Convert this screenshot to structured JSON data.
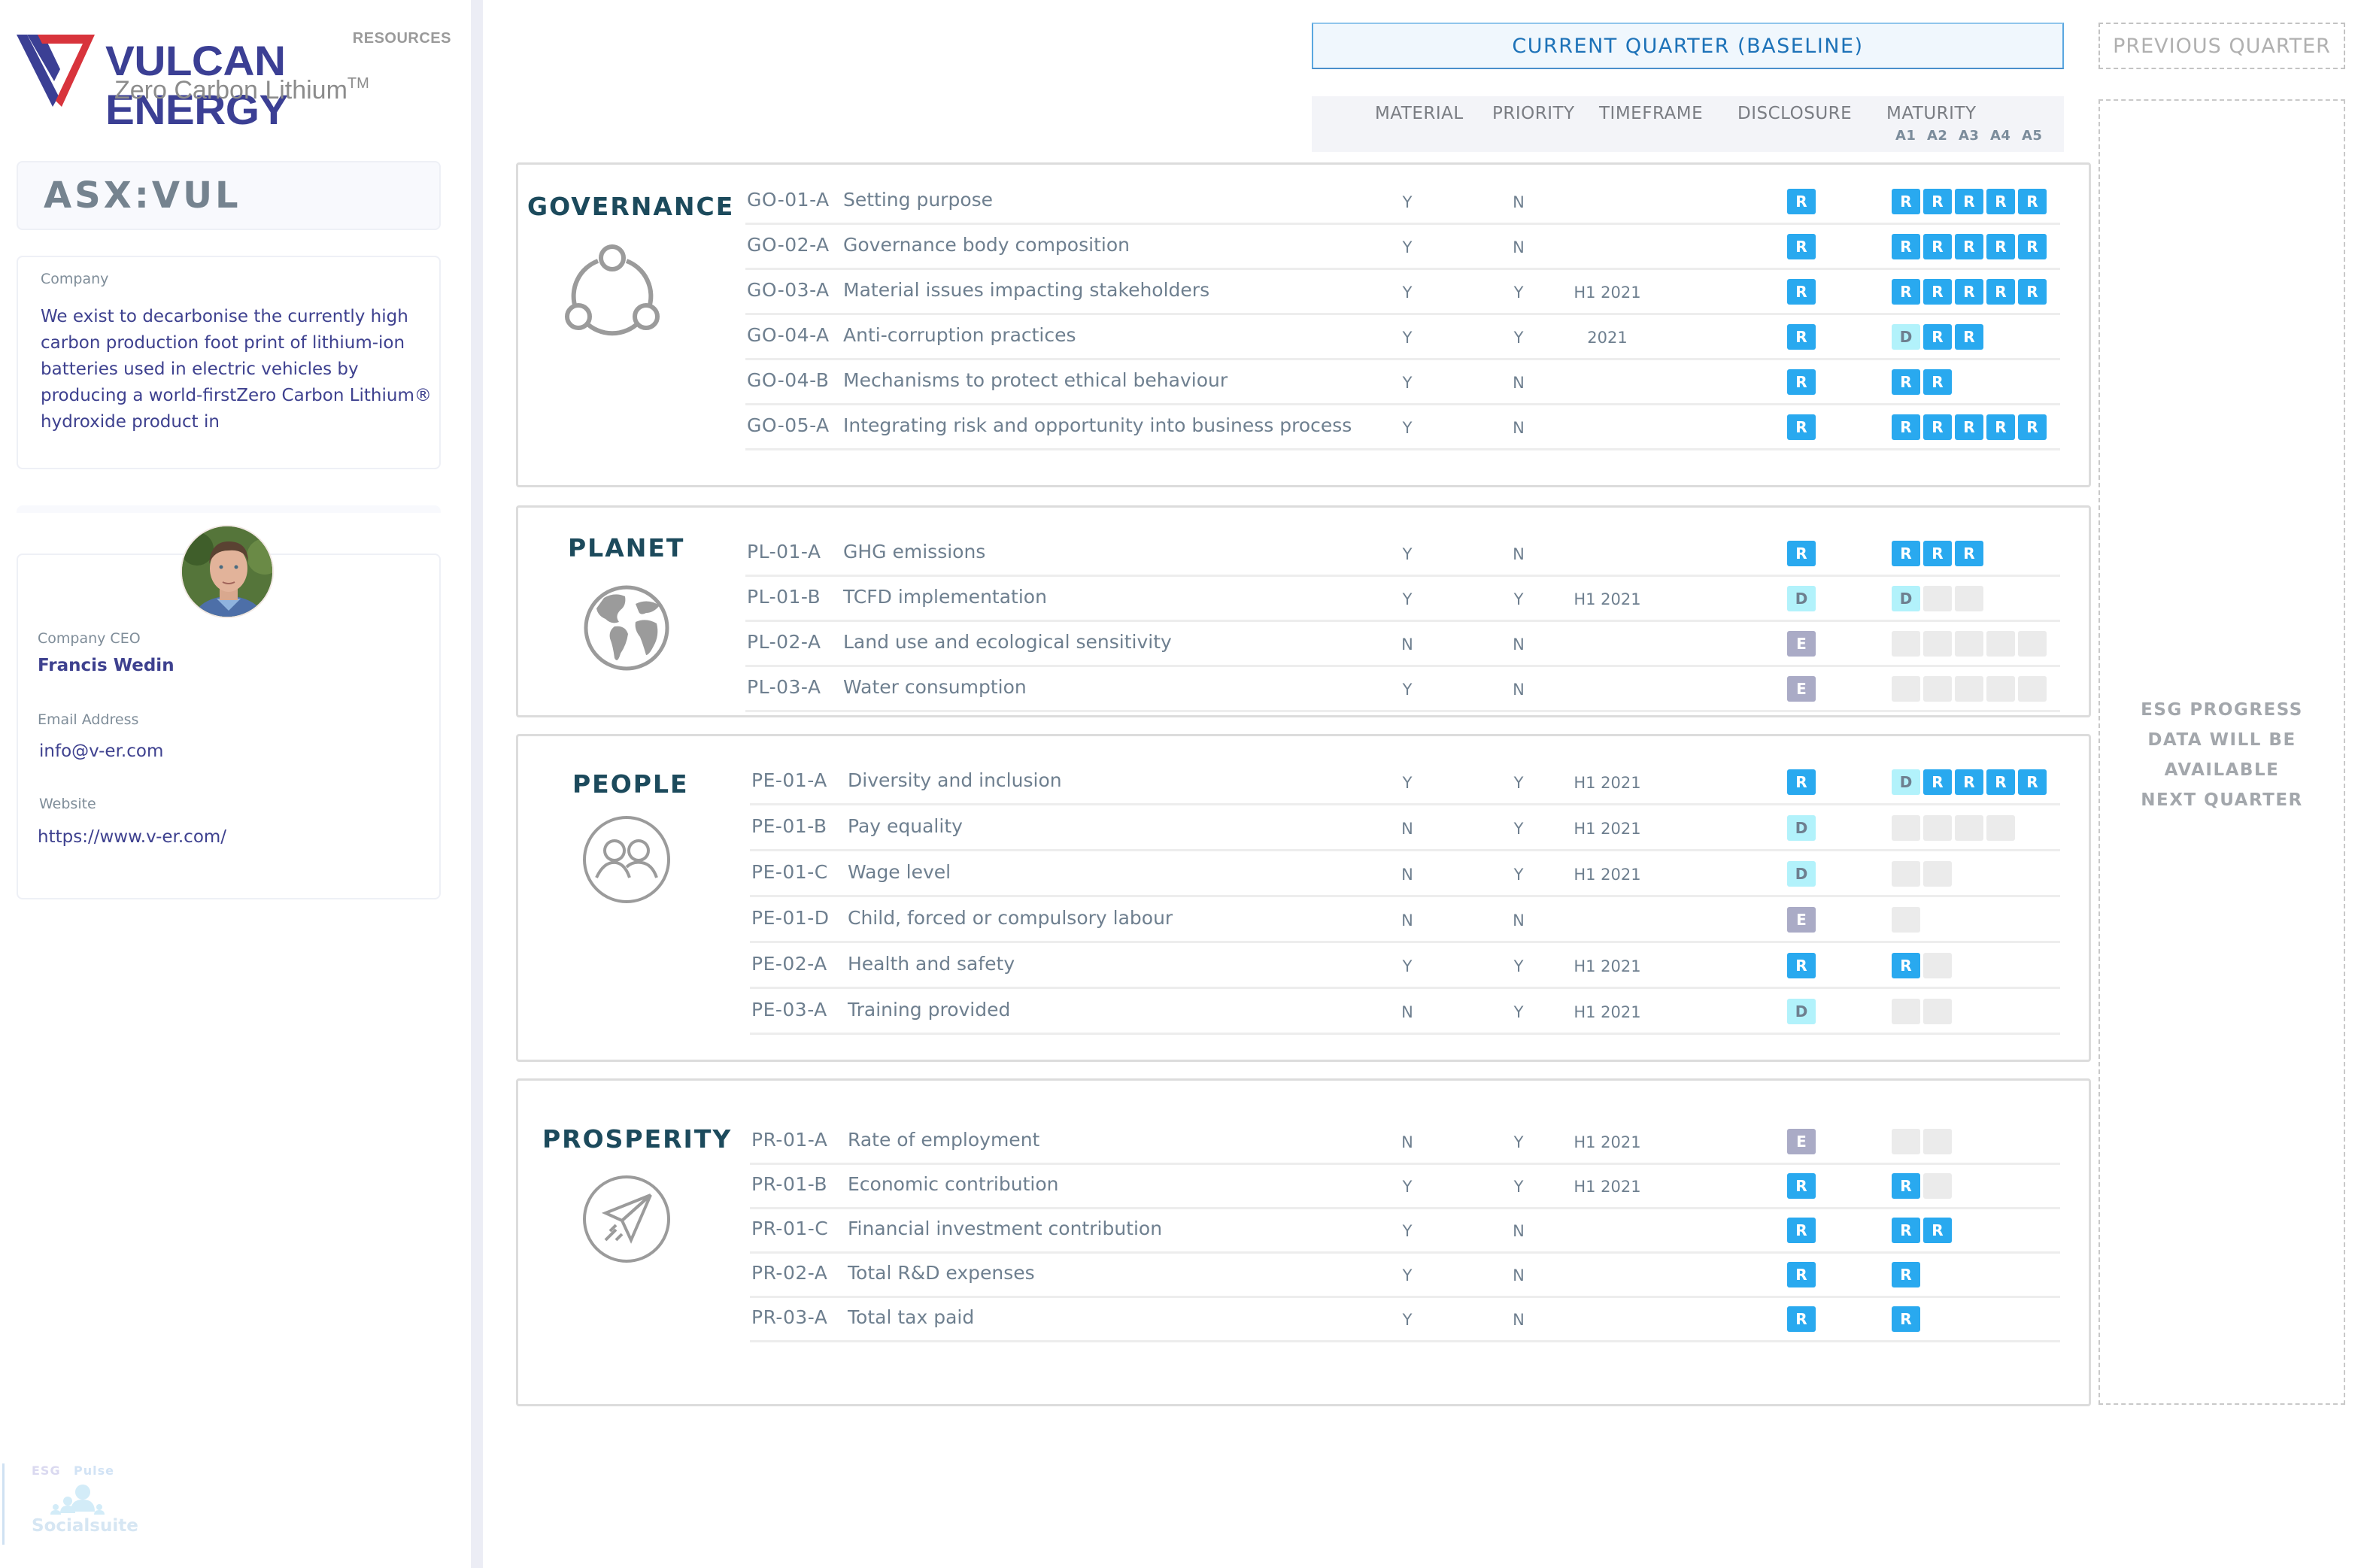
{
  "sidebar": {
    "logo": {
      "resources": "RESOURCES",
      "brand": "VULCAN ENERGY",
      "tagline": "Zero Carbon Lithium",
      "trademark": "TM"
    },
    "ticker": "ASX:VUL",
    "company": {
      "label": "Company",
      "description": "We exist to decarbonise the currently high carbon production foot print of lithium-ion batteries used in electric vehicles by producing a world-firstZero Carbon Lithium® hydroxide product in"
    },
    "ceo": {
      "ceo_label": "Company CEO",
      "ceo_name": "Francis Wedin",
      "email_label": "Email Address",
      "email": "info@v-er.com",
      "website_label": "Website",
      "website": "https://www.v-er.com/"
    },
    "powered_by": {
      "esg": "ESG",
      "pulse": "Pulse",
      "brand": "Socialsuite"
    }
  },
  "headers": {
    "current_quarter": "CURRENT QUARTER (BASELINE)",
    "previous_quarter": "PREVIOUS QUARTER",
    "columns": {
      "material": "MATERIAL",
      "priority": "PRIORITY",
      "timeframe": "TIMEFRAME",
      "disclosure": "DISCLOSURE",
      "maturity": "MATURITY",
      "maturity_levels": [
        "A1",
        "A2",
        "A3",
        "A4",
        "A5"
      ]
    },
    "previous_quarter_message": "ESG PROGRESS DATA WILL BE AVAILABLE NEXT QUARTER"
  },
  "legend_colors": {
    "R": "#29a9ef",
    "D": "#b2f2fb",
    "E": "#aaabc6",
    "empty": "#ebebeb",
    "section_title": "#1c4a5c"
  },
  "sections": [
    {
      "title": "GOVERNANCE",
      "icon": "share-network-icon",
      "rows": [
        {
          "code": "GO-01-A",
          "title": "Setting purpose",
          "material": "Y",
          "priority": "N",
          "timeframe": "",
          "disclosure": "R",
          "maturity": [
            "R",
            "R",
            "R",
            "R",
            "R"
          ]
        },
        {
          "code": "GO-02-A",
          "title": "Governance body composition",
          "material": "Y",
          "priority": "N",
          "timeframe": "",
          "disclosure": "R",
          "maturity": [
            "R",
            "R",
            "R",
            "R",
            "R"
          ]
        },
        {
          "code": "GO-03-A",
          "title": "Material issues impacting stakeholders",
          "material": "Y",
          "priority": "Y",
          "timeframe": "H1 2021",
          "disclosure": "R",
          "maturity": [
            "R",
            "R",
            "R",
            "R",
            "R"
          ]
        },
        {
          "code": "GO-04-A",
          "title": "Anti-corruption practices",
          "material": "Y",
          "priority": "Y",
          "timeframe": "2021",
          "disclosure": "R",
          "maturity": [
            "D",
            "R",
            "R"
          ]
        },
        {
          "code": "GO-04-B",
          "title": "Mechanisms to protect ethical behaviour",
          "material": "Y",
          "priority": "N",
          "timeframe": "",
          "disclosure": "R",
          "maturity": [
            "R",
            "R"
          ]
        },
        {
          "code": "GO-05-A",
          "title": "Integrating risk and opportunity into business process",
          "material": "Y",
          "priority": "N",
          "timeframe": "",
          "disclosure": "R",
          "maturity": [
            "R",
            "R",
            "R",
            "R",
            "R"
          ]
        }
      ]
    },
    {
      "title": "PLANET",
      "icon": "globe-icon",
      "rows": [
        {
          "code": "PL-01-A",
          "title": "GHG emissions",
          "material": "Y",
          "priority": "N",
          "timeframe": "",
          "disclosure": "R",
          "maturity": [
            "R",
            "R",
            "R"
          ]
        },
        {
          "code": "PL-01-B",
          "title": "TCFD implementation",
          "material": "Y",
          "priority": "Y",
          "timeframe": "H1 2021",
          "disclosure": "D",
          "maturity": [
            "D",
            "",
            ""
          ]
        },
        {
          "code": "PL-02-A",
          "title": "Land use and ecological sensitivity",
          "material": "N",
          "priority": "N",
          "timeframe": "",
          "disclosure": "E",
          "maturity": [
            "",
            "",
            "",
            "",
            ""
          ]
        },
        {
          "code": "PL-03-A",
          "title": "Water consumption",
          "material": "Y",
          "priority": "N",
          "timeframe": "",
          "disclosure": "E",
          "maturity": [
            "",
            "",
            "",
            "",
            ""
          ]
        }
      ]
    },
    {
      "title": "PEOPLE",
      "icon": "people-group-icon",
      "rows": [
        {
          "code": "PE-01-A",
          "title": "Diversity and inclusion",
          "material": "Y",
          "priority": "Y",
          "timeframe": "H1 2021",
          "disclosure": "R",
          "maturity": [
            "D",
            "R",
            "R",
            "R",
            "R"
          ]
        },
        {
          "code": "PE-01-B",
          "title": "Pay equality",
          "material": "N",
          "priority": "Y",
          "timeframe": "H1 2021",
          "disclosure": "D",
          "maturity": [
            "",
            "",
            "",
            ""
          ]
        },
        {
          "code": "PE-01-C",
          "title": "Wage level",
          "material": "N",
          "priority": "Y",
          "timeframe": "H1 2021",
          "disclosure": "D",
          "maturity": [
            "",
            ""
          ]
        },
        {
          "code": "PE-01-D",
          "title": "Child, forced or compulsory labour",
          "material": "N",
          "priority": "N",
          "timeframe": "",
          "disclosure": "E",
          "maturity": [
            ""
          ]
        },
        {
          "code": "PE-02-A",
          "title": "Health and safety",
          "material": "Y",
          "priority": "Y",
          "timeframe": "H1 2021",
          "disclosure": "R",
          "maturity": [
            "R",
            ""
          ]
        },
        {
          "code": "PE-03-A",
          "title": "Training provided",
          "material": "N",
          "priority": "Y",
          "timeframe": "H1 2021",
          "disclosure": "D",
          "maturity": [
            "",
            ""
          ]
        }
      ]
    },
    {
      "title": "PROSPERITY",
      "icon": "paper-plane-icon",
      "rows": [
        {
          "code": "PR-01-A",
          "title": "Rate of employment",
          "material": "N",
          "priority": "Y",
          "timeframe": "H1 2021",
          "disclosure": "E",
          "maturity": [
            "",
            ""
          ]
        },
        {
          "code": "PR-01-B",
          "title": "Economic contribution",
          "material": "Y",
          "priority": "Y",
          "timeframe": "H1 2021",
          "disclosure": "R",
          "maturity": [
            "R",
            ""
          ]
        },
        {
          "code": "PR-01-C",
          "title": "Financial investment contribution",
          "material": "Y",
          "priority": "N",
          "timeframe": "",
          "disclosure": "R",
          "maturity": [
            "R",
            "R"
          ]
        },
        {
          "code": "PR-02-A",
          "title": "Total R&D expenses",
          "material": "Y",
          "priority": "N",
          "timeframe": "",
          "disclosure": "R",
          "maturity": [
            "R"
          ]
        },
        {
          "code": "PR-03-A",
          "title": "Total tax paid",
          "material": "Y",
          "priority": "N",
          "timeframe": "",
          "disclosure": "R",
          "maturity": [
            "R"
          ]
        }
      ]
    }
  ]
}
